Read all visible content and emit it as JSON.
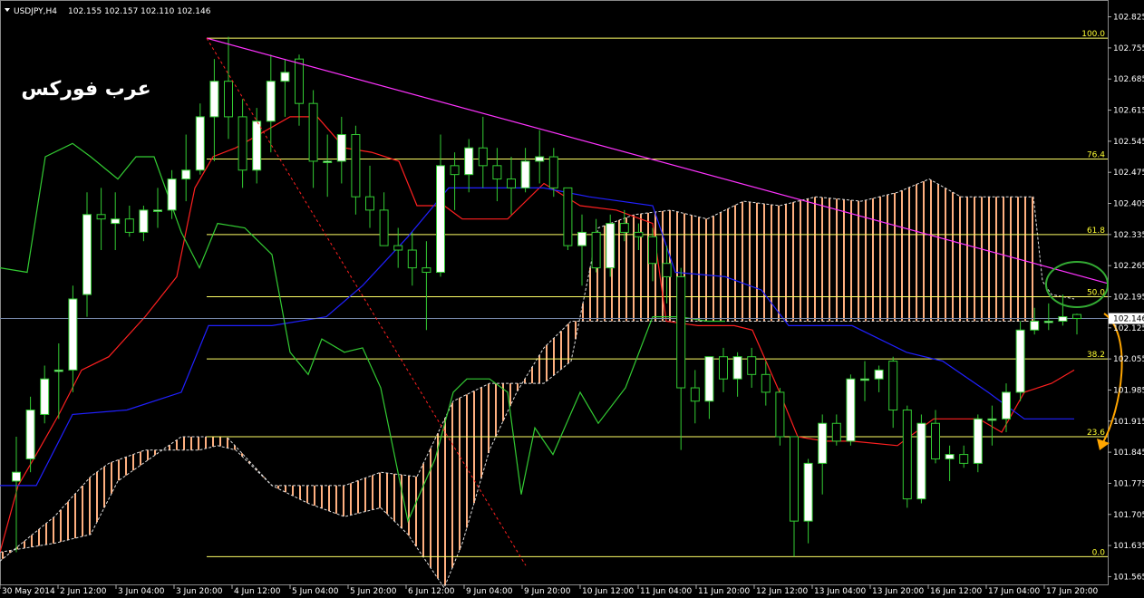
{
  "header": {
    "symbol": "USDJPY,H4",
    "ohlc": "102.155 102.157 102.110 102.146"
  },
  "watermark": "عرب فوركس",
  "current_price_label": "102.146",
  "colors": {
    "background": "#000000",
    "bull_candle": "#ffffff",
    "wick": "#33cc33",
    "tenkan": "#ff2020",
    "kijun": "#2020ff",
    "chikou": "#33cc33",
    "kumo_fill": "#ffb080",
    "fib": "#ffff66",
    "trendline": "#ff33ff",
    "red_diagonal": "#ff2020",
    "arrow": "#ffa500",
    "circle": "#33aa33"
  },
  "chart_data": {
    "type": "candlestick",
    "symbol": "USDJPY",
    "timeframe": "H4",
    "y_ticks": [
      "102.825",
      "102.755",
      "102.685",
      "102.615",
      "102.545",
      "102.475",
      "102.405",
      "102.335",
      "102.265",
      "102.195",
      "102.125",
      "102.055",
      "101.985",
      "101.915",
      "101.845",
      "101.775",
      "101.705",
      "101.635",
      "101.565"
    ],
    "x_ticks": [
      "30 May 2014",
      "2 Jun 12:00",
      "3 Jun 04:00",
      "3 Jun 20:00",
      "4 Jun 12:00",
      "5 Jun 04:00",
      "5 Jun 20:00",
      "6 Jun 12:00",
      "9 Jun 04:00",
      "9 Jun 20:00",
      "10 Jun 12:00",
      "11 Jun 04:00",
      "11 Jun 20:00",
      "12 Jun 12:00",
      "13 Jun 04:00",
      "13 Jun 20:00",
      "16 Jun 12:00",
      "17 Jun 04:00",
      "17 Jun 20:00"
    ],
    "fib_levels": [
      {
        "label": "100.0",
        "price": 102.777
      },
      {
        "label": "76.4",
        "price": 102.505
      },
      {
        "label": "61.8",
        "price": 102.335
      },
      {
        "label": "50.0",
        "price": 102.195
      },
      {
        "label": "38.2",
        "price": 102.055
      },
      {
        "label": "23.6",
        "price": 101.88
      },
      {
        "label": "0.0",
        "price": 101.61
      }
    ],
    "current_price": 102.146,
    "candles": [
      {
        "o": 101.78,
        "h": 101.88,
        "l": 101.62,
        "c": 101.8
      },
      {
        "o": 101.83,
        "h": 101.97,
        "l": 101.8,
        "c": 101.94
      },
      {
        "o": 101.93,
        "h": 102.04,
        "l": 101.91,
        "c": 102.01
      },
      {
        "o": 102.03,
        "h": 102.09,
        "l": 101.92,
        "c": 102.03
      },
      {
        "o": 102.03,
        "h": 102.22,
        "l": 101.98,
        "c": 102.19
      },
      {
        "o": 102.2,
        "h": 102.43,
        "l": 102.15,
        "c": 102.38
      },
      {
        "o": 102.38,
        "h": 102.44,
        "l": 102.3,
        "c": 102.37
      },
      {
        "o": 102.36,
        "h": 102.43,
        "l": 102.3,
        "c": 102.37
      },
      {
        "o": 102.37,
        "h": 102.4,
        "l": 102.33,
        "c": 102.34
      },
      {
        "o": 102.34,
        "h": 102.4,
        "l": 102.32,
        "c": 102.39
      },
      {
        "o": 102.39,
        "h": 102.44,
        "l": 102.35,
        "c": 102.39
      },
      {
        "o": 102.39,
        "h": 102.48,
        "l": 102.37,
        "c": 102.46
      },
      {
        "o": 102.46,
        "h": 102.56,
        "l": 102.41,
        "c": 102.48
      },
      {
        "o": 102.48,
        "h": 102.63,
        "l": 102.47,
        "c": 102.6
      },
      {
        "o": 102.6,
        "h": 102.73,
        "l": 102.5,
        "c": 102.68
      },
      {
        "o": 102.68,
        "h": 102.78,
        "l": 102.55,
        "c": 102.6
      },
      {
        "o": 102.6,
        "h": 102.64,
        "l": 102.44,
        "c": 102.48
      },
      {
        "o": 102.48,
        "h": 102.62,
        "l": 102.45,
        "c": 102.59
      },
      {
        "o": 102.59,
        "h": 102.74,
        "l": 102.52,
        "c": 102.68
      },
      {
        "o": 102.68,
        "h": 102.73,
        "l": 102.6,
        "c": 102.7
      },
      {
        "o": 102.73,
        "h": 102.74,
        "l": 102.58,
        "c": 102.63
      },
      {
        "o": 102.63,
        "h": 102.66,
        "l": 102.44,
        "c": 102.5
      },
      {
        "o": 102.5,
        "h": 102.56,
        "l": 102.42,
        "c": 102.5
      },
      {
        "o": 102.5,
        "h": 102.6,
        "l": 102.45,
        "c": 102.56
      },
      {
        "o": 102.56,
        "h": 102.58,
        "l": 102.38,
        "c": 102.42
      },
      {
        "o": 102.42,
        "h": 102.49,
        "l": 102.35,
        "c": 102.39
      },
      {
        "o": 102.39,
        "h": 102.43,
        "l": 102.31,
        "c": 102.31
      },
      {
        "o": 102.31,
        "h": 102.35,
        "l": 102.26,
        "c": 102.3
      },
      {
        "o": 102.3,
        "h": 102.34,
        "l": 102.22,
        "c": 102.26
      },
      {
        "o": 102.26,
        "h": 102.32,
        "l": 102.12,
        "c": 102.25
      },
      {
        "o": 102.25,
        "h": 102.56,
        "l": 102.24,
        "c": 102.49
      },
      {
        "o": 102.49,
        "h": 102.52,
        "l": 102.39,
        "c": 102.47
      },
      {
        "o": 102.47,
        "h": 102.55,
        "l": 102.43,
        "c": 102.53
      },
      {
        "o": 102.53,
        "h": 102.6,
        "l": 102.44,
        "c": 102.49
      },
      {
        "o": 102.49,
        "h": 102.53,
        "l": 102.41,
        "c": 102.46
      },
      {
        "o": 102.46,
        "h": 102.51,
        "l": 102.38,
        "c": 102.44
      },
      {
        "o": 102.44,
        "h": 102.53,
        "l": 102.43,
        "c": 102.5
      },
      {
        "o": 102.5,
        "h": 102.57,
        "l": 102.45,
        "c": 102.51
      },
      {
        "o": 102.51,
        "h": 102.53,
        "l": 102.42,
        "c": 102.44
      },
      {
        "o": 102.44,
        "h": 102.44,
        "l": 102.3,
        "c": 102.31
      },
      {
        "o": 102.31,
        "h": 102.38,
        "l": 102.22,
        "c": 102.34
      },
      {
        "o": 102.34,
        "h": 102.37,
        "l": 102.25,
        "c": 102.26
      },
      {
        "o": 102.26,
        "h": 102.38,
        "l": 102.24,
        "c": 102.36
      },
      {
        "o": 102.36,
        "h": 102.39,
        "l": 102.32,
        "c": 102.34
      },
      {
        "o": 102.34,
        "h": 102.36,
        "l": 102.3,
        "c": 102.33
      },
      {
        "o": 102.33,
        "h": 102.35,
        "l": 102.23,
        "c": 102.27
      },
      {
        "o": 102.27,
        "h": 102.31,
        "l": 102.18,
        "c": 102.24
      },
      {
        "o": 102.24,
        "h": 102.26,
        "l": 101.85,
        "c": 101.99
      },
      {
        "o": 101.99,
        "h": 102.03,
        "l": 101.91,
        "c": 101.96
      },
      {
        "o": 101.96,
        "h": 102.05,
        "l": 101.92,
        "c": 102.06
      },
      {
        "o": 102.06,
        "h": 102.08,
        "l": 101.98,
        "c": 102.01
      },
      {
        "o": 102.01,
        "h": 102.07,
        "l": 101.97,
        "c": 102.06
      },
      {
        "o": 102.06,
        "h": 102.08,
        "l": 101.99,
        "c": 102.02
      },
      {
        "o": 102.02,
        "h": 102.05,
        "l": 101.95,
        "c": 101.98
      },
      {
        "o": 101.98,
        "h": 101.99,
        "l": 101.86,
        "c": 101.88
      },
      {
        "o": 101.88,
        "h": 101.88,
        "l": 101.61,
        "c": 101.69
      },
      {
        "o": 101.69,
        "h": 101.83,
        "l": 101.64,
        "c": 101.82
      },
      {
        "o": 101.82,
        "h": 101.93,
        "l": 101.75,
        "c": 101.91
      },
      {
        "o": 101.91,
        "h": 101.93,
        "l": 101.86,
        "c": 101.87
      },
      {
        "o": 101.87,
        "h": 102.02,
        "l": 101.86,
        "c": 102.01
      },
      {
        "o": 102.01,
        "h": 102.05,
        "l": 101.96,
        "c": 102.01
      },
      {
        "o": 102.01,
        "h": 102.04,
        "l": 101.98,
        "c": 102.03
      },
      {
        "o": 102.05,
        "h": 102.06,
        "l": 101.9,
        "c": 101.94
      },
      {
        "o": 101.94,
        "h": 101.95,
        "l": 101.72,
        "c": 101.74
      },
      {
        "o": 101.74,
        "h": 101.93,
        "l": 101.73,
        "c": 101.91
      },
      {
        "o": 101.91,
        "h": 101.94,
        "l": 101.82,
        "c": 101.83
      },
      {
        "o": 101.83,
        "h": 101.86,
        "l": 101.78,
        "c": 101.84
      },
      {
        "o": 101.84,
        "h": 101.86,
        "l": 101.81,
        "c": 101.82
      },
      {
        "o": 101.82,
        "h": 101.93,
        "l": 101.8,
        "c": 101.92
      },
      {
        "o": 101.92,
        "h": 101.95,
        "l": 101.86,
        "c": 101.92
      },
      {
        "o": 101.92,
        "h": 102.0,
        "l": 101.89,
        "c": 101.98
      },
      {
        "o": 101.98,
        "h": 102.14,
        "l": 101.96,
        "c": 102.12
      },
      {
        "o": 102.12,
        "h": 102.17,
        "l": 102.11,
        "c": 102.14
      },
      {
        "o": 102.14,
        "h": 102.18,
        "l": 102.12,
        "c": 102.14
      },
      {
        "o": 102.14,
        "h": 102.2,
        "l": 102.13,
        "c": 102.15
      },
      {
        "o": 102.155,
        "h": 102.157,
        "l": 102.11,
        "c": 102.146
      }
    ],
    "tenkan": [
      [
        0,
        101.62
      ],
      [
        20,
        101.77
      ],
      [
        40,
        101.84
      ],
      [
        65,
        101.93
      ],
      [
        90,
        102.03
      ],
      [
        120,
        102.06
      ],
      [
        160,
        102.15
      ],
      [
        195,
        102.24
      ],
      [
        215,
        102.44
      ],
      [
        235,
        102.51
      ],
      [
        260,
        102.53
      ],
      [
        320,
        102.6
      ],
      [
        350,
        102.6
      ],
      [
        380,
        102.53
      ],
      [
        410,
        102.52
      ],
      [
        440,
        102.5
      ],
      [
        460,
        102.4
      ],
      [
        490,
        102.4
      ],
      [
        510,
        102.37
      ],
      [
        560,
        102.37
      ],
      [
        600,
        102.45
      ],
      [
        640,
        102.4
      ],
      [
        680,
        102.39
      ],
      [
        720,
        102.36
      ],
      [
        735,
        102.14
      ],
      [
        770,
        102.13
      ],
      [
        810,
        102.13
      ],
      [
        830,
        102.12
      ],
      [
        860,
        101.98
      ],
      [
        880,
        101.88
      ],
      [
        910,
        101.87
      ],
      [
        940,
        101.87
      ],
      [
        990,
        101.86
      ],
      [
        1030,
        101.92
      ],
      [
        1080,
        101.92
      ],
      [
        1105,
        101.89
      ],
      [
        1130,
        101.98
      ],
      [
        1160,
        102.0
      ],
      [
        1185,
        102.03
      ]
    ],
    "kijun": [
      [
        0,
        101.77
      ],
      [
        40,
        101.77
      ],
      [
        60,
        101.85
      ],
      [
        80,
        101.93
      ],
      [
        140,
        101.94
      ],
      [
        200,
        101.98
      ],
      [
        230,
        102.13
      ],
      [
        300,
        102.13
      ],
      [
        360,
        102.15
      ],
      [
        400,
        102.22
      ],
      [
        450,
        102.33
      ],
      [
        495,
        102.44
      ],
      [
        540,
        102.44
      ],
      [
        600,
        102.44
      ],
      [
        650,
        102.42
      ],
      [
        720,
        102.4
      ],
      [
        745,
        102.25
      ],
      [
        800,
        102.24
      ],
      [
        840,
        102.21
      ],
      [
        870,
        102.13
      ],
      [
        940,
        102.13
      ],
      [
        1000,
        102.07
      ],
      [
        1040,
        102.05
      ],
      [
        1090,
        101.98
      ],
      [
        1130,
        101.92
      ],
      [
        1185,
        101.92
      ]
    ],
    "chikou": [
      [
        0,
        102.26
      ],
      [
        30,
        102.25
      ],
      [
        50,
        102.51
      ],
      [
        80,
        102.54
      ],
      [
        100,
        102.51
      ],
      [
        130,
        102.46
      ],
      [
        150,
        102.51
      ],
      [
        170,
        102.51
      ],
      [
        200,
        102.34
      ],
      [
        220,
        102.26
      ],
      [
        240,
        102.36
      ],
      [
        270,
        102.35
      ],
      [
        300,
        102.29
      ],
      [
        320,
        102.07
      ],
      [
        340,
        102.02
      ],
      [
        355,
        102.1
      ],
      [
        380,
        102.07
      ],
      [
        400,
        102.08
      ],
      [
        420,
        101.99
      ],
      [
        450,
        101.69
      ],
      [
        480,
        101.83
      ],
      [
        500,
        101.98
      ],
      [
        515,
        102.01
      ],
      [
        540,
        102.01
      ],
      [
        560,
        101.98
      ],
      [
        575,
        101.75
      ],
      [
        590,
        101.9
      ],
      [
        610,
        101.84
      ],
      [
        640,
        101.98
      ],
      [
        660,
        101.91
      ],
      [
        690,
        101.99
      ],
      [
        720,
        102.15
      ],
      [
        750,
        102.15
      ],
      [
        780,
        102.14
      ],
      [
        800,
        102.14
      ]
    ],
    "kumo_a": [
      [
        0,
        101.6
      ],
      [
        30,
        101.65
      ],
      [
        60,
        101.7
      ],
      [
        100,
        101.79
      ],
      [
        120,
        101.82
      ],
      [
        160,
        101.85
      ],
      [
        220,
        101.85
      ],
      [
        240,
        101.86
      ],
      [
        260,
        101.85
      ],
      [
        300,
        101.77
      ],
      [
        340,
        101.73
      ],
      [
        380,
        101.7
      ],
      [
        420,
        101.72
      ],
      [
        450,
        101.66
      ],
      [
        490,
        101.54
      ],
      [
        510,
        101.64
      ],
      [
        540,
        101.85
      ],
      [
        570,
        101.98
      ],
      [
        600,
        102.08
      ],
      [
        630,
        102.14
      ],
      [
        640,
        102.14
      ],
      [
        720,
        102.14
      ],
      [
        900,
        102.14
      ],
      [
        1000,
        102.14
      ],
      [
        1140,
        102.14
      ]
    ],
    "kumo_b": [
      [
        0,
        101.62
      ],
      [
        60,
        101.64
      ],
      [
        100,
        101.66
      ],
      [
        130,
        101.78
      ],
      [
        200,
        101.88
      ],
      [
        250,
        101.88
      ],
      [
        300,
        101.77
      ],
      [
        380,
        101.77
      ],
      [
        420,
        101.8
      ],
      [
        460,
        101.79
      ],
      [
        500,
        101.96
      ],
      [
        540,
        102.0
      ],
      [
        560,
        102.0
      ],
      [
        600,
        102.0
      ],
      [
        630,
        102.05
      ],
      [
        660,
        102.35
      ],
      [
        700,
        102.38
      ],
      [
        740,
        102.39
      ],
      [
        780,
        102.37
      ],
      [
        820,
        102.41
      ],
      [
        860,
        102.4
      ],
      [
        900,
        102.42
      ],
      [
        950,
        102.41
      ],
      [
        990,
        102.43
      ],
      [
        1025,
        102.46
      ],
      [
        1060,
        102.42
      ],
      [
        1110,
        102.42
      ],
      [
        1140,
        102.42
      ],
      [
        1150,
        102.23
      ],
      [
        1160,
        102.2
      ],
      [
        1185,
        102.19
      ]
    ]
  }
}
